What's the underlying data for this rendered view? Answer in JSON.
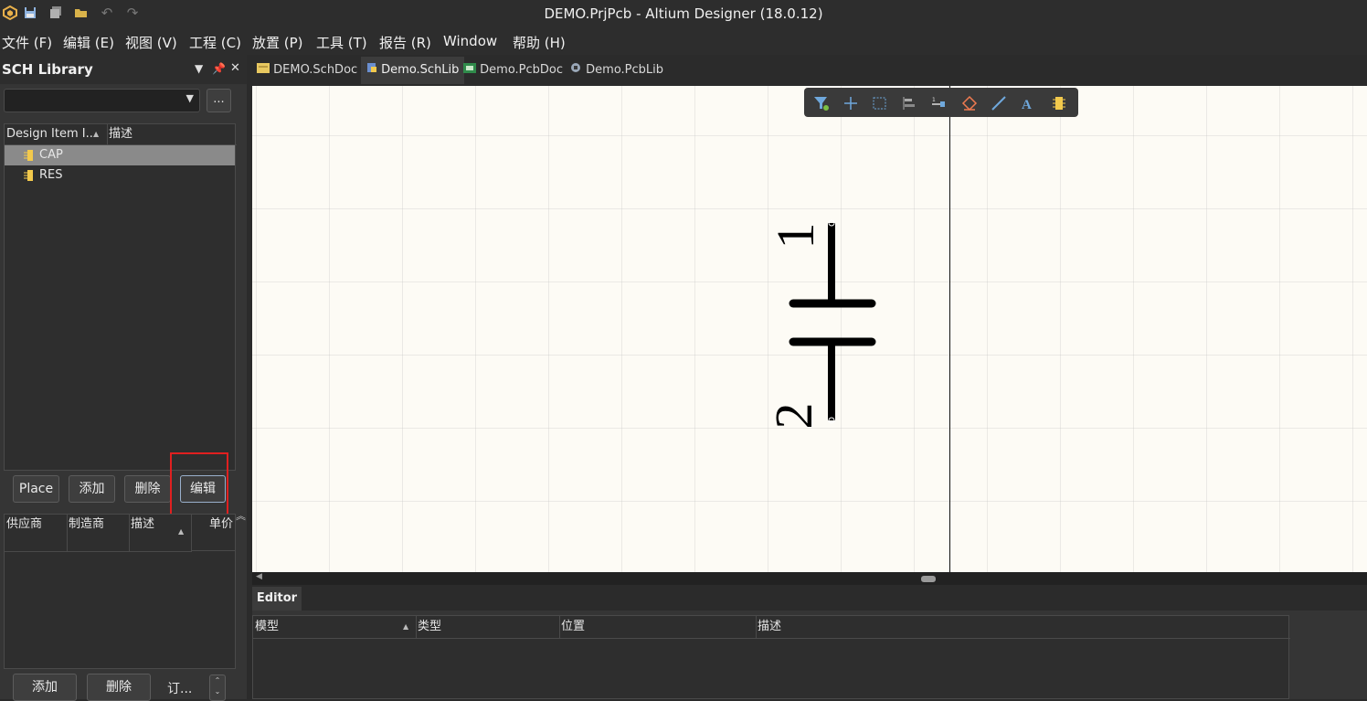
{
  "window": {
    "title": "DEMO.PrjPcb - Altium Designer (18.0.12)"
  },
  "menu": [
    "文件 (F)",
    "编辑 (E)",
    "视图 (V)",
    "工程 (C)",
    "放置 (P)",
    "工具 (T)",
    "报告 (R)",
    "Window",
    "帮助 (H)"
  ],
  "panel": {
    "title": "SCH Library",
    "more_button": "...",
    "columns": [
      "Design Item I...",
      "描述"
    ],
    "items": [
      {
        "name": "CAP",
        "selected": true
      },
      {
        "name": "RES",
        "selected": false
      }
    ],
    "buttons": {
      "place": "Place",
      "add": "添加",
      "delete": "删除",
      "edit": "编辑"
    },
    "supplier_columns": [
      "供应商",
      "制造商",
      "描述",
      "单价"
    ],
    "bottom_buttons": {
      "add": "添加",
      "delete": "删除",
      "order": "订..."
    }
  },
  "tabs": [
    {
      "label": "DEMO.SchDoc",
      "active": false
    },
    {
      "label": "Demo.SchLib",
      "active": true
    },
    {
      "label": "Demo.PcbDoc",
      "active": false
    },
    {
      "label": "Demo.PcbLib",
      "active": false
    }
  ],
  "canvas": {
    "pin_labels": {
      "top": "1",
      "bottom": "2"
    }
  },
  "editor": {
    "tab_label": "Editor",
    "columns": [
      "模型",
      "类型",
      "位置",
      "描述"
    ]
  },
  "colors": {
    "highlight_box": "#e02020",
    "canvas_bg": "#fdfbf5",
    "accent": "#4a90d9"
  }
}
